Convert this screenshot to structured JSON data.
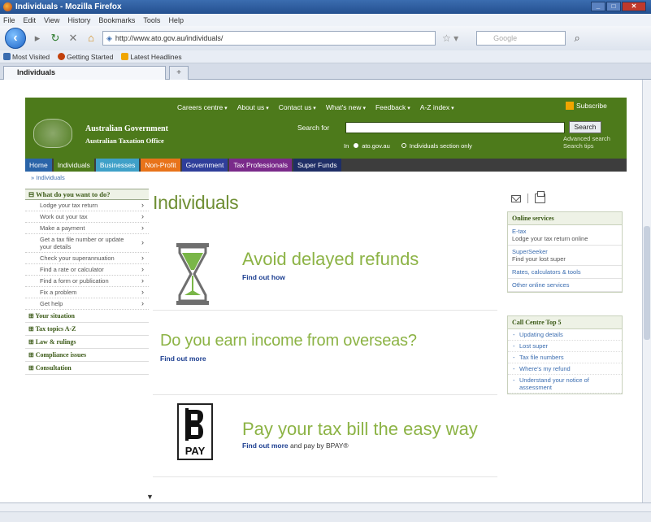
{
  "window": {
    "title": "Individuals - Mozilla Firefox"
  },
  "menu": [
    "File",
    "Edit",
    "View",
    "History",
    "Bookmarks",
    "Tools",
    "Help"
  ],
  "nav": {
    "url": "http://www.ato.gov.au/individuals/",
    "search_placeholder": "Google"
  },
  "bookmarks": [
    {
      "label": "Most Visited",
      "color": "#3b6db0"
    },
    {
      "label": "Getting Started",
      "color": "#c2410c"
    },
    {
      "label": "Latest Headlines",
      "color": "#f0a500"
    }
  ],
  "tab": {
    "label": "Individuals",
    "new_tab": "+"
  },
  "ato": {
    "govt": "Australian Government",
    "office": "Australian Taxation Office",
    "topnav": [
      "Careers centre",
      "About us",
      "Contact us",
      "What's new",
      "Feedback",
      "A-Z index"
    ],
    "subscribe": "Subscribe",
    "search_for": "Search for",
    "search_button": "Search",
    "advanced": "Advanced search",
    "search_tips": "Search tips",
    "in_label": "In",
    "radio1": "ato.gov.au",
    "radio2": "Individuals section only"
  },
  "tabs": [
    {
      "label": "Home",
      "color": "#2a64a8"
    },
    {
      "label": "Individuals",
      "color": "#4d7a1b"
    },
    {
      "label": "Businesses",
      "color": "#3fa0c8"
    },
    {
      "label": "Non-Profit",
      "color": "#e8731a"
    },
    {
      "label": "Government",
      "color": "#2f3e9a"
    },
    {
      "label": "Tax Professionals",
      "color": "#7a2a8a"
    },
    {
      "label": "Super Funds",
      "color": "#1f2e66"
    }
  ],
  "breadcrumb": "» Individuals",
  "leftnav": {
    "heading": "What do you want to do?",
    "items": [
      "Lodge your tax return",
      "Work out your tax",
      "Make a payment",
      "Get a tax file number or update your details",
      "Check your superannuation",
      "Find a rate or calculator",
      "Find a form or publication",
      "Fix a problem",
      "Get help"
    ],
    "sections": [
      "Your situation",
      "Tax topics A-Z",
      "Law & rulings",
      "Compliance issues",
      "Consultation"
    ]
  },
  "main": {
    "title": "Individuals",
    "promo1": {
      "title": "Avoid delayed refunds",
      "link": "Find out how"
    },
    "promo2": {
      "title": "Do you earn income from overseas?",
      "link": "Find out more"
    },
    "promo3": {
      "title": "Pay your tax bill the easy way",
      "link": "Find out more",
      "suffix": "and pay by BPAY®",
      "logo_text": "PAY"
    }
  },
  "right": {
    "online_services": {
      "heading": "Online services",
      "items": [
        {
          "title": "E-tax",
          "desc": "Lodge your tax return online"
        },
        {
          "title": "SuperSeeker",
          "desc": "Find your lost super"
        },
        {
          "title": "Rates, calculators & tools",
          "desc": ""
        },
        {
          "title": "Other online services",
          "desc": ""
        }
      ]
    },
    "call_centre": {
      "heading": "Call Centre Top 5",
      "items": [
        "Updating details",
        "Lost super",
        "Tax file numbers",
        "Where's my refund",
        "Understand your notice of assessment"
      ]
    }
  },
  "colors": {
    "ato_green": "#4d7a1b",
    "promo_green": "#8cb345",
    "link_blue": "#1d3f91"
  }
}
